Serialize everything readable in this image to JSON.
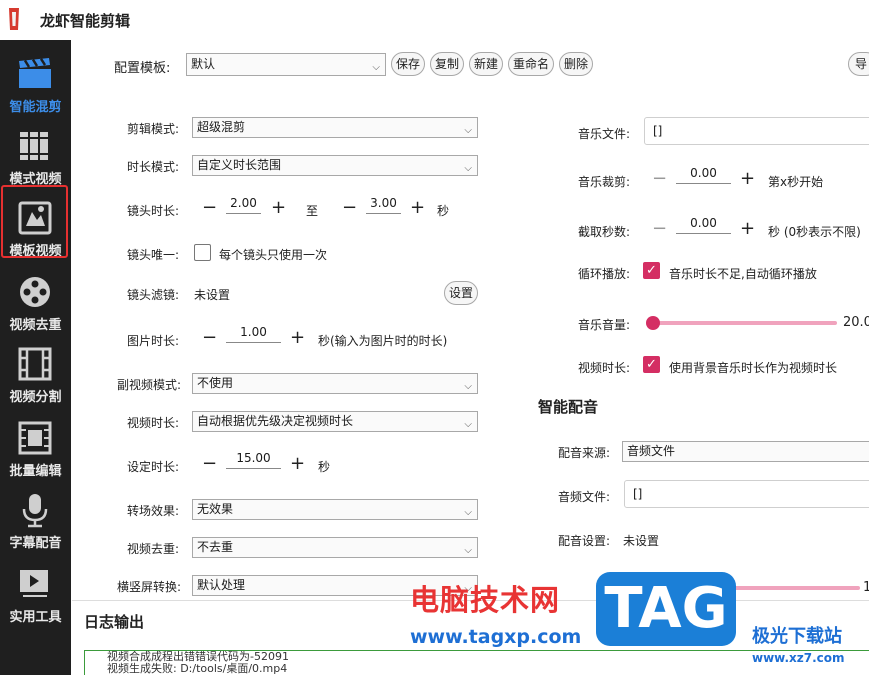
{
  "app": {
    "title": "龙虾智能剪辑"
  },
  "colors": {
    "sidebar_bg": "#1f1f1f",
    "active_blue": "#3c8de8",
    "accent_pink": "#d42e63",
    "selection_red": "#e63030"
  },
  "sidebar": {
    "items": [
      {
        "label": "智能混剪",
        "icon": "clapperboard-icon",
        "active": true
      },
      {
        "label": "模式视频",
        "icon": "books-icon"
      },
      {
        "label": "模板视频",
        "icon": "template-icon"
      },
      {
        "label": "视频去重",
        "icon": "film-reel-icon"
      },
      {
        "label": "视频分割",
        "icon": "film-strip-icon"
      },
      {
        "label": "批量编辑",
        "icon": "batch-edit-icon"
      },
      {
        "label": "字幕配音",
        "icon": "microphone-icon"
      },
      {
        "label": "实用工具",
        "icon": "logo-tool-icon"
      }
    ]
  },
  "toolbar": {
    "config_label": "配置模板:",
    "config_value": "默认",
    "save": "保存",
    "copy": "复制",
    "new": "新建",
    "rename": "重命名",
    "delete": "删除",
    "import": "导"
  },
  "left": {
    "edit_mode_label": "剪辑模式:",
    "edit_mode_value": "超级混剪",
    "duration_mode_label": "时长模式:",
    "duration_mode_value": "自定义时长范围",
    "shot_len_label": "镜头时长:",
    "shot_min": "2.00",
    "to": "至",
    "shot_max": "3.00",
    "sec": "秒",
    "unique_label": "镜头唯一:",
    "unique_text": "每个镜头只使用一次",
    "filter_label": "镜头滤镜:",
    "filter_value": "未设置",
    "filter_btn": "设置",
    "img_len_label": "图片时长:",
    "img_len": "1.00",
    "img_len_note": "秒(输入为图片时的时长)",
    "sub_mode_label": "副视频模式:",
    "sub_mode_value": "不使用",
    "video_len_label": "视频时长:",
    "video_len_value": "自动根据优先级决定视频时长",
    "set_len_label": "设定时长:",
    "set_len": "15.00",
    "set_len_unit": "秒",
    "transition_label": "转场效果:",
    "transition_value": "无效果",
    "dedupe_label": "视频去重:",
    "dedupe_value": "不去重",
    "orient_label": "横竖屏转换:",
    "orient_value": "默认处理"
  },
  "right": {
    "music_file_label": "音乐文件:",
    "music_file_value": "[]",
    "music_cut_label": "音乐裁剪:",
    "music_cut": "0.00",
    "music_cut_note": "第x秒开始",
    "clip_sec_label": "截取秒数:",
    "clip_sec": "0.00",
    "clip_sec_note": "秒 (0秒表示不限)",
    "loop_label": "循环播放:",
    "loop_text": "音乐时长不足,自动循环播放",
    "volume_label": "音乐音量:",
    "volume_value": "20.0",
    "volume_fraction": 0.0,
    "vlen_label": "视频时长:",
    "vlen_text": "使用背景音乐时长作为视频时长",
    "dub_title": "智能配音",
    "dub_source_label": "配音来源:",
    "dub_source_value": "音频文件",
    "audio_file_label": "音频文件:",
    "audio_file_value": "[]",
    "dub_setting_label": "配音设置:",
    "dub_setting_value": "未设置",
    "dub_volume_value": "1"
  },
  "log": {
    "title": "日志输出",
    "lines": [
      "视频合成成程出错错误代码为-52091",
      "视频生成失败: D:/tools/桌面/0.mp4"
    ]
  },
  "watermark": {
    "site_cn": "电脑技术网",
    "site_url": "www.tagxp.com",
    "tag": "TAG",
    "brand_cn": "极光下载站",
    "brand_url": "www.xz7.com"
  }
}
